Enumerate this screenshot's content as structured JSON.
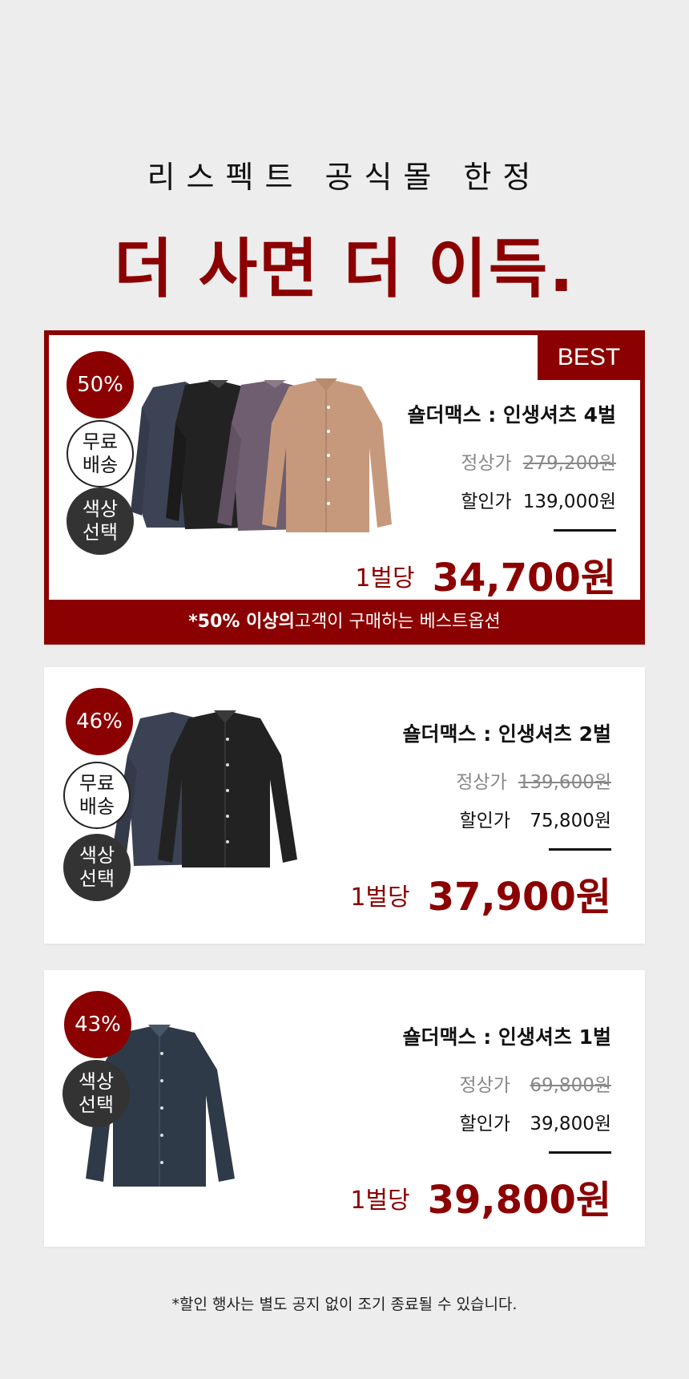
{
  "header": {
    "subtitle": "리스펙트 공식몰 한정",
    "headline": "더 사면 더 이득."
  },
  "colors": {
    "accent": "#8b0000",
    "dark_badge": "#333333",
    "background": "#ededed"
  },
  "products": [
    {
      "best_tag": "BEST",
      "discount": "50%",
      "free_shipping": "무료 배송",
      "color_select": "색상 선택",
      "name": "숄더맥스 : 인생셔츠 4벌",
      "regular_label": "정상가",
      "regular_price": "279,200원",
      "sale_label": "할인가",
      "sale_price": "139,000원",
      "per_label": "1벌당",
      "per_price": "34,700원",
      "bottom_note_bold": "*50% 이상의",
      "bottom_note_rest": " 고객이 구매하는 베스트옵션"
    },
    {
      "discount": "46%",
      "free_shipping": "무료 배송",
      "color_select": "색상 선택",
      "name": "숄더맥스 : 인생셔츠 2벌",
      "regular_label": "정상가",
      "regular_price": "139,600원",
      "sale_label": "할인가",
      "sale_price": "75,800원",
      "per_label": "1벌당",
      "per_price": "37,900원"
    },
    {
      "discount": "43%",
      "color_select": "색상 선택",
      "name": "숄더맥스 : 인생셔츠 1벌",
      "regular_label": "정상가",
      "regular_price": "69,800원",
      "sale_label": "할인가",
      "sale_price": "39,800원",
      "per_label": "1벌당",
      "per_price": "39,800원"
    }
  ],
  "footnote": "*할인 행사는 별도 공지 없이 조기 종료될 수 있습니다."
}
